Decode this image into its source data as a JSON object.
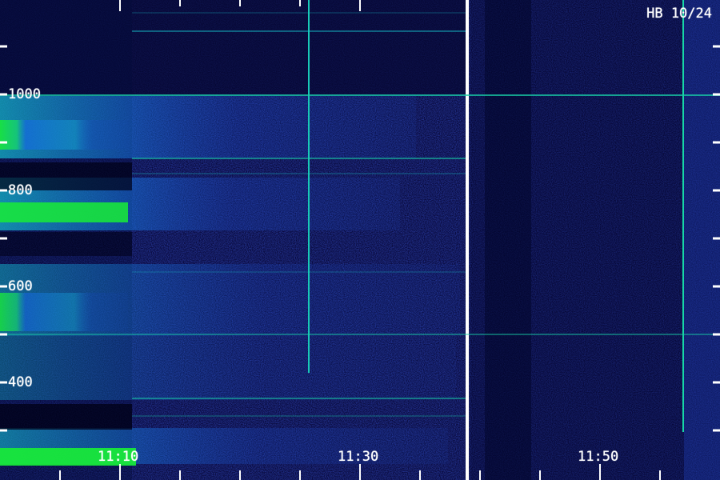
{
  "app": {
    "station_label": "HB 10/24"
  },
  "axes": {
    "y_ticks": [
      "1000",
      "800",
      "600",
      "400"
    ],
    "x_ticks": [
      "11:10",
      "11:30",
      "11:50"
    ]
  },
  "colors": {
    "background": "#08083a",
    "blue": "#1937d8",
    "bright_blue": "#2f61ff",
    "cyan": "#15b8d8",
    "green": "#18e83a",
    "white": "#ffffff"
  }
}
